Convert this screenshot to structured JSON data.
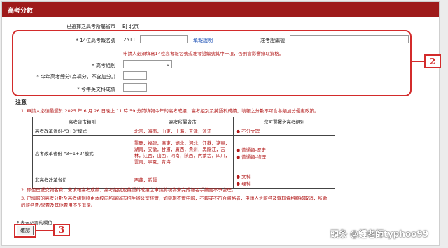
{
  "header": {
    "title": "高考分數"
  },
  "form": {
    "province_label": "已選擇之高考所屬省市",
    "province_value": "BJ  北京",
    "exam_no_label": "* 14位高考報名號",
    "exam_no_value": "2511",
    "fill_help_link": "填報說明",
    "admission_label": "准考證編號",
    "admission_value": "",
    "warning": "申請人必須填寫14位高考報名號或准考證編號其中一項，否則會影響錄取資格。",
    "group_label": "* 高考組別",
    "group_value": "",
    "total_label": "* 今年高考總分(為裸分，不含加分。)",
    "total_value": "",
    "english_label": "* 今年英文科成績",
    "english_value": ""
  },
  "notes": {
    "title": "注意",
    "note1": "1. 申請人必須最遲於 2025 年 6 月 26 日晚上 11 時 59 分前填報今年的高考成績，高考組別及英語科成績，填報之分數不可含各類加分優惠政策。",
    "note2": "2. 即使已遞交報名費，未填報高考成績、高考組別及英語科成績之申請將視為未完成報名手續而不予處理。",
    "note3a": "3. 已填報的高考分數及高考組別將由本校向所屬省市招生辦公室核實，如發現不實申報，不報或不符合資格者，申請人之報名及錄取資格將被取消，所繳",
    "note3b": "   的報名費/學費及其他費用不予退還。",
    "required": "* 表示必要的欄位"
  },
  "table": {
    "headers": [
      "高考省市類別",
      "高考所屬省市",
      "您可選擇之高考組別"
    ],
    "rows": [
      {
        "category": "高考改革省份-\"3+3\"模式",
        "provinces": "北京，海南，山東，上海，天津，浙江",
        "groups": [
          "不分文理"
        ]
      },
      {
        "category": "高考改革省份-\"3+1+2\"模式",
        "provinces": "重慶，福建，廣東，湖北，河北，江蘇，遼寧，湖南，安徽，甘肅，廣西，貴州，黑龍江，吉林，江西，山西，河南，陝西，內蒙古，四川，雲南，寧夏，青海",
        "groups": [
          "普通類-歷史",
          "普通類-物理"
        ]
      },
      {
        "category": "非高考改革省份",
        "provinces": "西藏，新疆",
        "groups": [
          "文科",
          "理科"
        ]
      }
    ]
  },
  "buttons": {
    "confirm": "確認"
  },
  "annotations": {
    "box2": "2",
    "box3": "3"
  },
  "watermark": {
    "text": "頭条 @鍾老師typhoo99"
  },
  "colors": {
    "header_bg": "#9e1b1b",
    "warning_text": "#b31b1b",
    "link": "#1a4fb5",
    "annotation_red": "#d32b2b"
  }
}
